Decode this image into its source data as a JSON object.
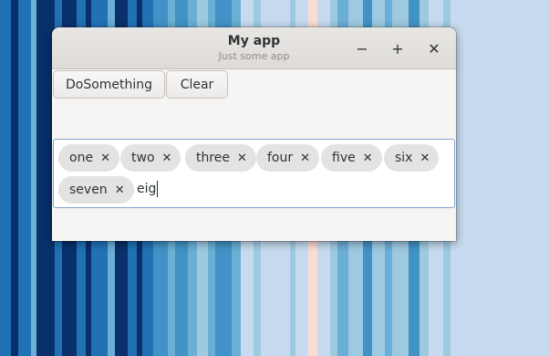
{
  "window": {
    "title": "My app",
    "subtitle": "Just some app",
    "controls": {
      "minimize": "−",
      "maximize": "+",
      "close": "✕"
    }
  },
  "toolbar": {
    "do_something_label": "DoSomething",
    "clear_label": "Clear"
  },
  "tag_entry": {
    "tags": [
      "one",
      "two",
      "three",
      "four",
      "five",
      "six",
      "seven"
    ],
    "remove_glyph": "✕",
    "typed_text": "eig"
  },
  "background": {
    "stripe_colors": [
      "#08306b",
      "#2171b5",
      "#6baed6",
      "#c6dbef",
      "#fcdcd0",
      "#9ecae1",
      "#4292c6"
    ]
  }
}
